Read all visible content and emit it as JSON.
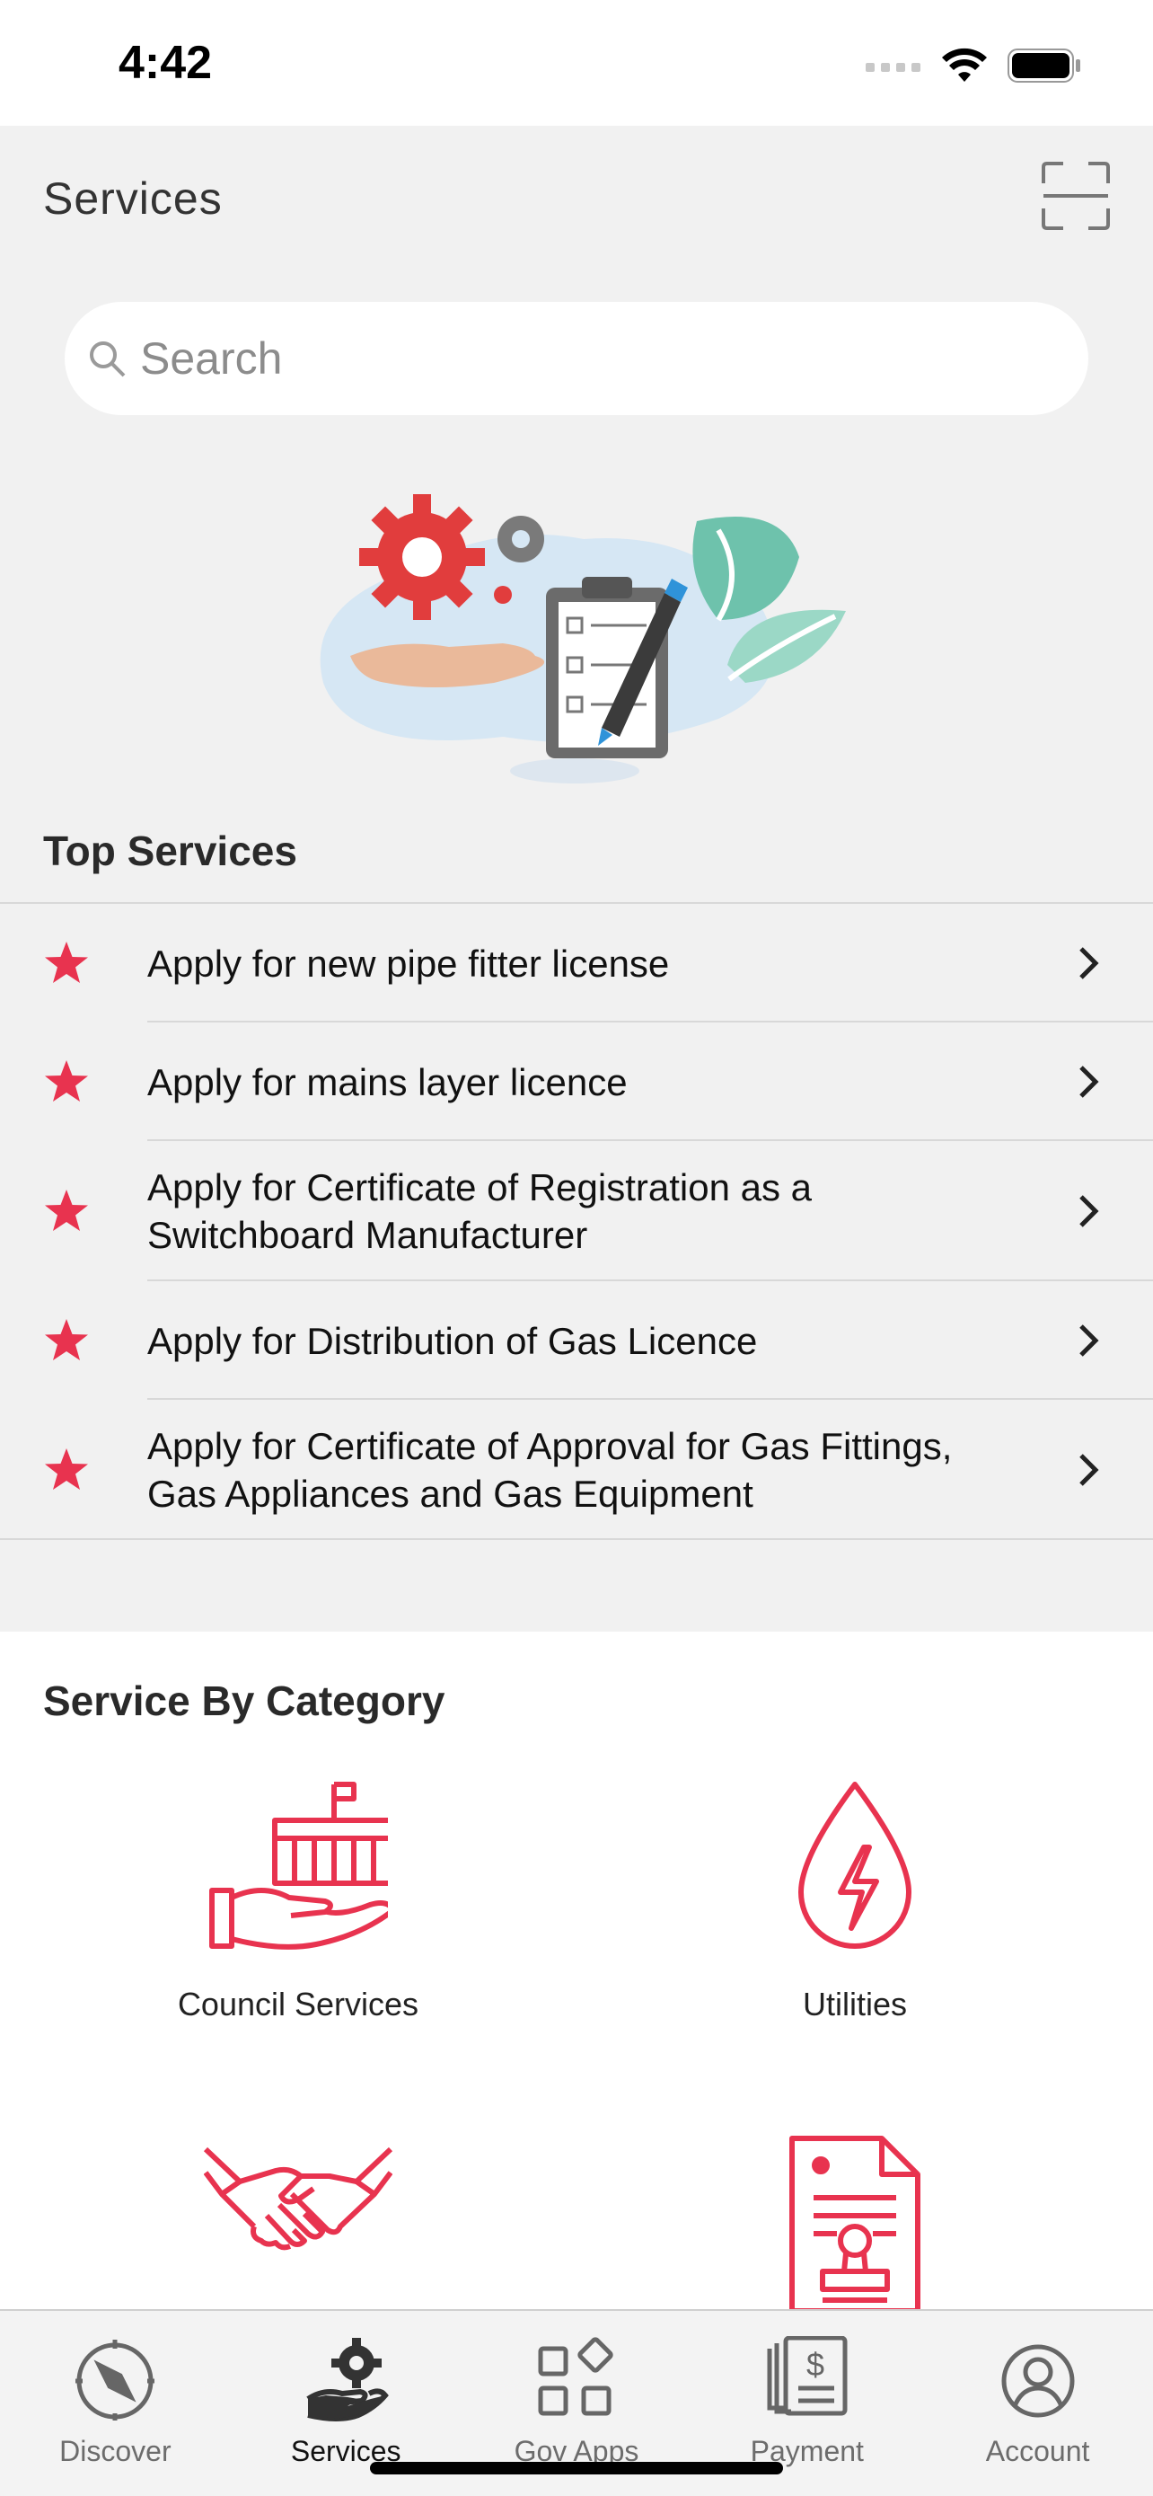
{
  "status_bar": {
    "time": "4:42"
  },
  "header": {
    "title": "Services",
    "scan_icon": "scan-frame-icon"
  },
  "search": {
    "placeholder": "Search",
    "value": ""
  },
  "top_services": {
    "title": "Top Services",
    "items": [
      {
        "label": "Apply for new pipe fitter license"
      },
      {
        "label": "Apply for mains layer licence"
      },
      {
        "label": "Apply for Certificate of Registration as a Switchboard Manufacturer"
      },
      {
        "label": "Apply for Distribution of Gas Licence"
      },
      {
        "label": "Apply for Certificate of Approval for Gas Fittings, Gas Appliances and Gas Equipment"
      }
    ]
  },
  "categories": {
    "title": "Service By Category",
    "items": [
      {
        "label": "Council Services",
        "icon": "council-building-hand-icon"
      },
      {
        "label": "Utilities",
        "icon": "utilities-drop-lightning-icon"
      },
      {
        "label": "",
        "icon": "handshake-icon"
      },
      {
        "label": "",
        "icon": "document-stamp-icon"
      }
    ]
  },
  "tab_bar": {
    "items": [
      {
        "label": "Discover",
        "icon": "compass-icon",
        "active": false
      },
      {
        "label": "Services",
        "icon": "gear-hand-icon",
        "active": true
      },
      {
        "label": "Gov Apps",
        "icon": "apps-grid-icon",
        "active": false
      },
      {
        "label": "Payment",
        "icon": "bill-payment-icon",
        "active": false
      },
      {
        "label": "Account",
        "icon": "account-person-icon",
        "active": false
      }
    ]
  },
  "colors": {
    "accent": "#e8334f",
    "background": "#f1f1f1"
  }
}
